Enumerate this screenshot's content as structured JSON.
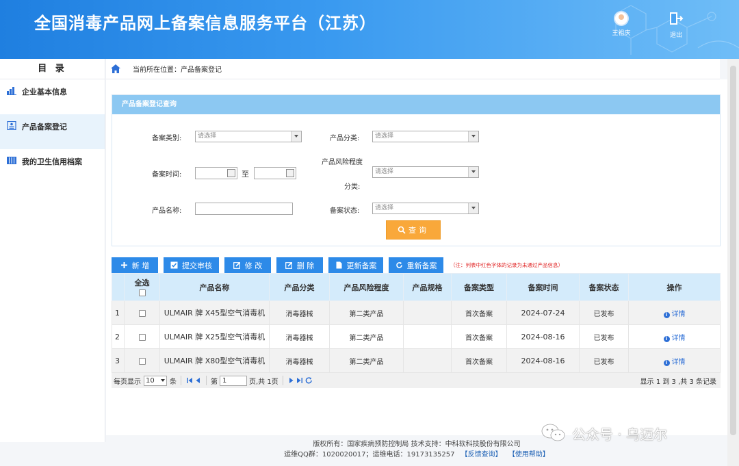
{
  "header": {
    "title": "全国消毒产品网上备案信息服务平台（江苏）",
    "user_name": "王祖庆",
    "logout_label": "退出"
  },
  "sidebar": {
    "title": "目 录",
    "items": [
      {
        "label": "企业基本信息",
        "icon": "bar-chart-icon",
        "active": false
      },
      {
        "label": "产品备案登记",
        "icon": "id-card-icon",
        "active": true
      },
      {
        "label": "我的卫生信用档案",
        "icon": "archive-icon",
        "active": false
      }
    ]
  },
  "breadcrumb": {
    "text": "当前所在位置：产品备案登记"
  },
  "query": {
    "panel_title": "产品备案登记查询",
    "type_label": "备案类别:",
    "type_placeholder": "请选择",
    "category_label": "产品分类:",
    "category_placeholder": "请选择",
    "date_label": "备案时间:",
    "date_to": "至",
    "risk_label_1": "产品风险程度",
    "risk_label_2": "分类:",
    "risk_placeholder": "请选择",
    "name_label": "产品名称:",
    "status_label": "备案状态:",
    "status_placeholder": "请选择",
    "search_label": "查询"
  },
  "toolbar": {
    "add": "新 增",
    "submit": "提交审核",
    "edit": "修 改",
    "delete": "删 除",
    "update": "更新备案",
    "refile": "重新备案",
    "note": "（注：列表中红色字体的记录为未通过产品信息）"
  },
  "table": {
    "headers": {
      "select_all": "全选",
      "name": "产品名称",
      "category": "产品分类",
      "risk": "产品风险程度",
      "spec": "产品规格",
      "type": "备案类型",
      "time": "备案时间",
      "status": "备案状态",
      "action": "操作"
    },
    "rows": [
      {
        "no": "1",
        "name": "ULMAIR 牌 X45型空气消毒机",
        "category": "消毒器械",
        "risk": "第二类产品",
        "spec": "",
        "type": "首次备案",
        "time": "2024-07-24",
        "status": "已发布",
        "action": "详情"
      },
      {
        "no": "2",
        "name": "ULMAIR 牌 X25型空气消毒机",
        "category": "消毒器械",
        "risk": "第二类产品",
        "spec": "",
        "type": "首次备案",
        "time": "2024-08-16",
        "status": "已发布",
        "action": "详情"
      },
      {
        "no": "3",
        "name": "ULMAIR 牌 X80型空气消毒机",
        "category": "消毒器械",
        "risk": "第二类产品",
        "spec": "",
        "type": "首次备案",
        "time": "2024-08-16",
        "status": "已发布",
        "action": "详情"
      }
    ]
  },
  "pager": {
    "per_page_label": "每页显示",
    "per_page_value": "10",
    "per_page_unit": "条",
    "page_prefix": "第",
    "page_value": "1",
    "page_suffix": "页,共 1页",
    "summary": "显示 1 到 3 ,共 3 条记录"
  },
  "footer": {
    "line1": "版权所有：国家疾病预防控制局  技术支持：中科软科技股份有限公司",
    "line2": "运维QQ群：1020020017；运维电话：19173135257",
    "feedback": "【反馈查询】",
    "help": "【使用帮助】"
  },
  "watermark": {
    "text": "公众号 · 乌迈尔"
  },
  "colors": {
    "header_blue": "#1f7fe0",
    "button_blue": "#2d8ae8",
    "search_orange": "#f9a83a",
    "panel_head": "#8cc8f2",
    "note_red": "#e02020"
  }
}
